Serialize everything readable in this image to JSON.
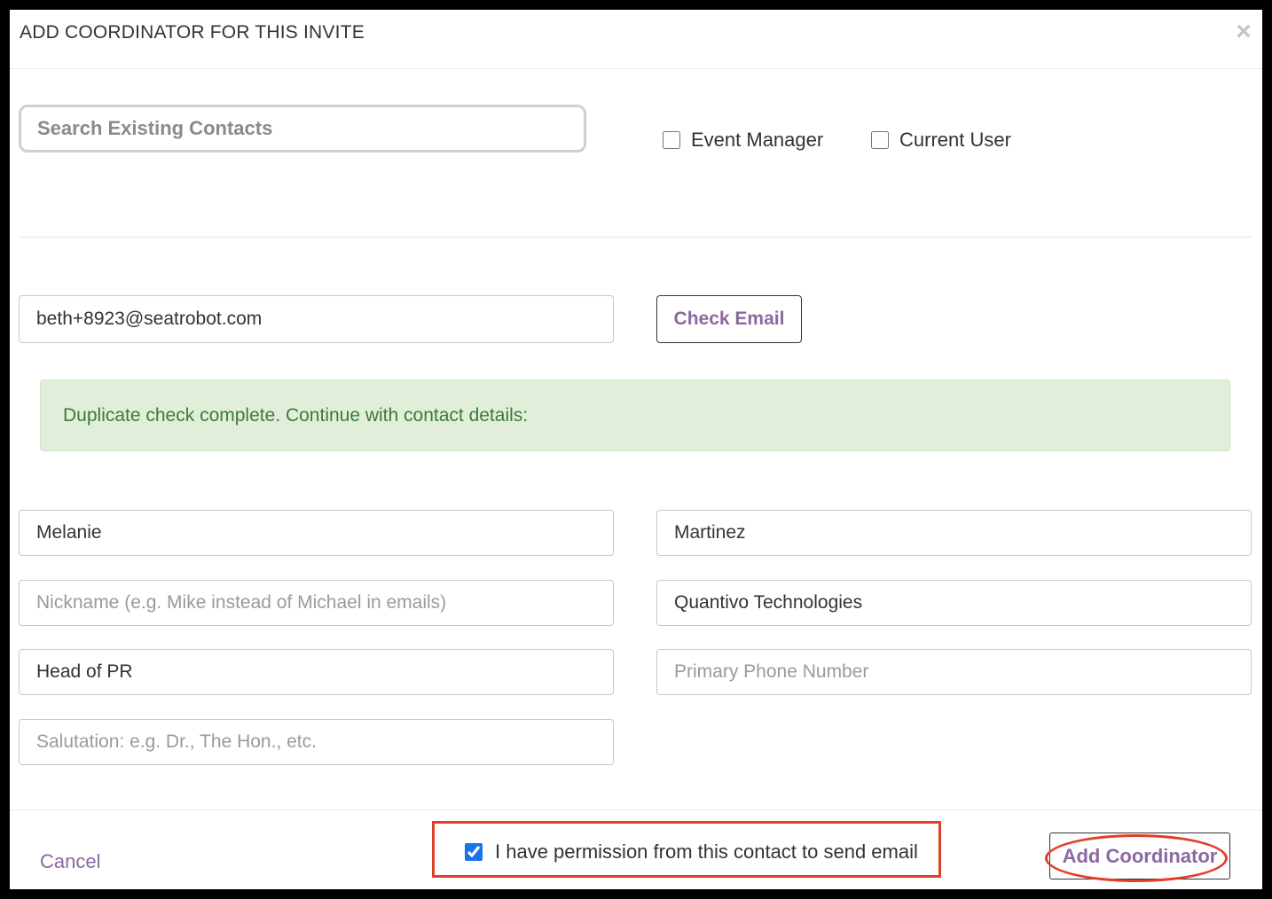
{
  "dialog": {
    "title": "ADD COORDINATOR FOR THIS INVITE",
    "close_symbol": "×"
  },
  "search": {
    "placeholder": "Search Existing Contacts",
    "value": ""
  },
  "filters": {
    "event_manager_label": "Event Manager",
    "event_manager_checked": false,
    "current_user_label": "Current User",
    "current_user_checked": false
  },
  "email": {
    "value": "beth+8923@seatrobot.com",
    "check_button_label": "Check Email"
  },
  "alert": {
    "message": "Duplicate check complete. Continue with contact details:",
    "color": "#e1efda"
  },
  "contact": {
    "first_name": "Melanie",
    "last_name": "Martinez",
    "nickname_placeholder": "Nickname (e.g. Mike instead of Michael in emails)",
    "nickname": "",
    "company": "Quantivo Technologies",
    "title": "Head of PR",
    "phone_placeholder": "Primary Phone Number",
    "phone": "",
    "salutation_placeholder": "Salutation: e.g. Dr., The Hon., etc.",
    "salutation": ""
  },
  "footer": {
    "cancel_label": "Cancel",
    "permission_label": "I have permission from this contact to send email",
    "permission_checked": true,
    "add_button_label": "Add Coordinator"
  },
  "colors": {
    "accent": "#8a6aa0",
    "highlight": "#e0402a",
    "success_text": "#3c7a3c"
  }
}
